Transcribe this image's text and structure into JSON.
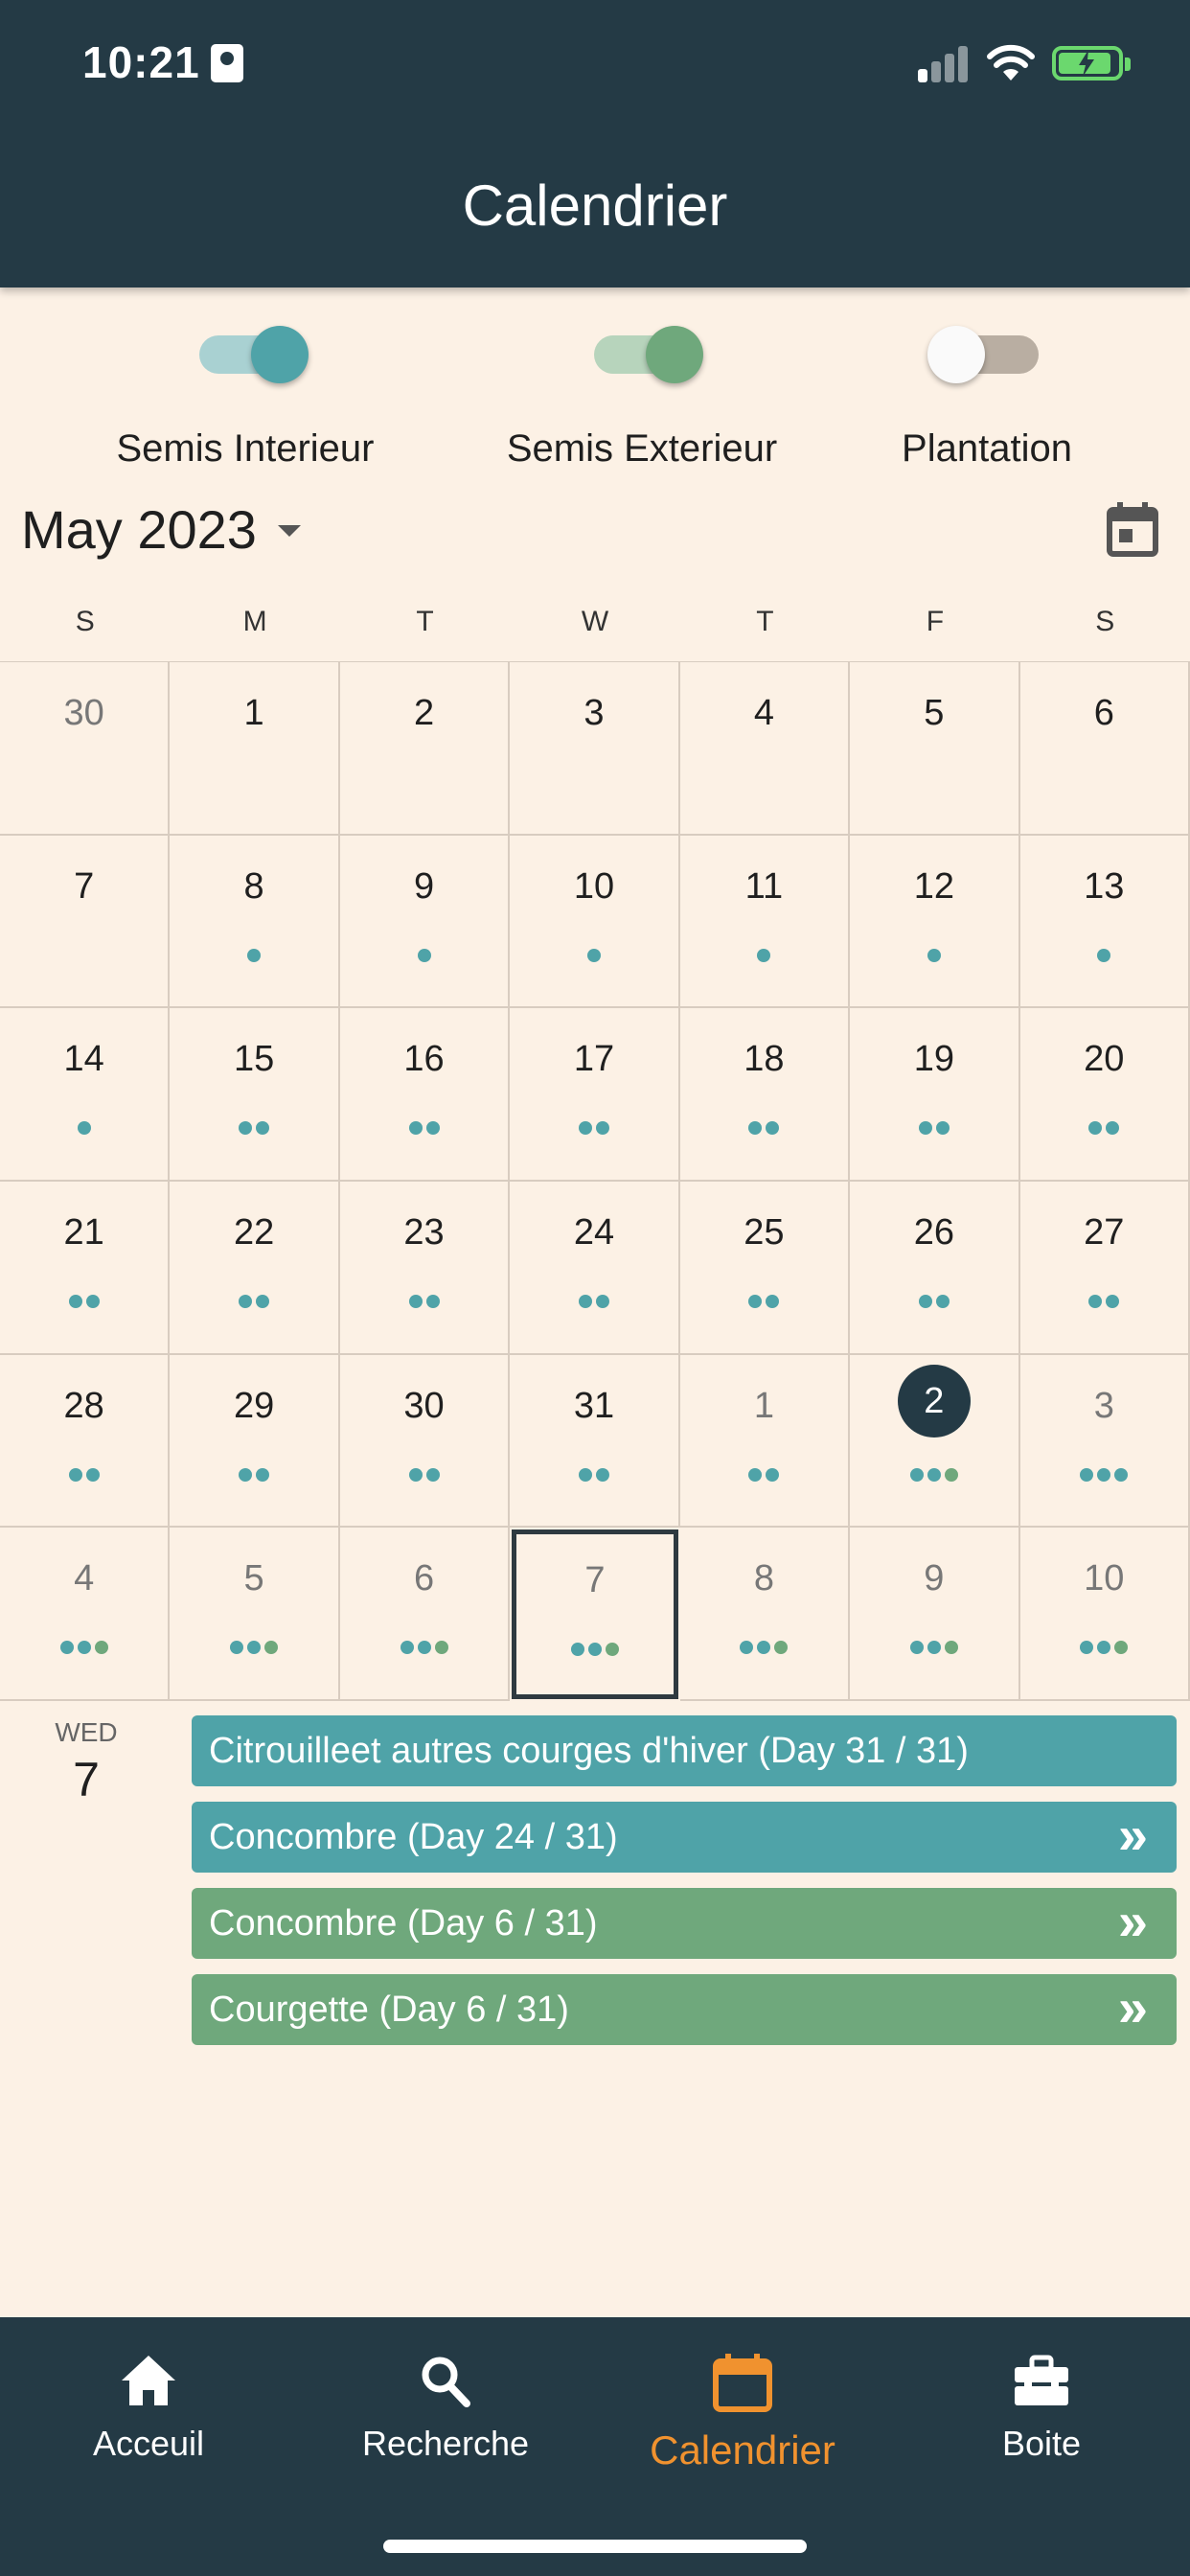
{
  "status_bar": {
    "time": "10:21"
  },
  "header": {
    "title": "Calendrier"
  },
  "filters": [
    {
      "label": "Semis Interieur",
      "on": true,
      "color": "#4FA3A8"
    },
    {
      "label": "Semis Exterieur",
      "on": true,
      "color": "#6FA87C"
    },
    {
      "label": "Plantation",
      "on": false,
      "color": "#B9AEA2"
    }
  ],
  "month_title": "May 2023",
  "weekdays": [
    "S",
    "M",
    "T",
    "W",
    "T",
    "F",
    "S"
  ],
  "colors": {
    "teal": "#4FA3A8",
    "green": "#6FA87C",
    "dark": "#243A45",
    "accent": "#F0922F",
    "background": "#FCF1E5"
  },
  "calendar_days": [
    {
      "d": "30",
      "m": true,
      "dots": []
    },
    {
      "d": "1",
      "dots": []
    },
    {
      "d": "2",
      "dots": []
    },
    {
      "d": "3",
      "dots": []
    },
    {
      "d": "4",
      "dots": []
    },
    {
      "d": "5",
      "dots": []
    },
    {
      "d": "6",
      "dots": []
    },
    {
      "d": "7",
      "dots": []
    },
    {
      "d": "8",
      "dots": [
        "teal"
      ]
    },
    {
      "d": "9",
      "dots": [
        "teal"
      ]
    },
    {
      "d": "10",
      "dots": [
        "teal"
      ]
    },
    {
      "d": "11",
      "dots": [
        "teal"
      ]
    },
    {
      "d": "12",
      "dots": [
        "teal"
      ]
    },
    {
      "d": "13",
      "dots": [
        "teal"
      ]
    },
    {
      "d": "14",
      "dots": [
        "teal"
      ]
    },
    {
      "d": "15",
      "dots": [
        "teal",
        "teal"
      ]
    },
    {
      "d": "16",
      "dots": [
        "teal",
        "teal"
      ]
    },
    {
      "d": "17",
      "dots": [
        "teal",
        "teal"
      ]
    },
    {
      "d": "18",
      "dots": [
        "teal",
        "teal"
      ]
    },
    {
      "d": "19",
      "dots": [
        "teal",
        "teal"
      ]
    },
    {
      "d": "20",
      "dots": [
        "teal",
        "teal"
      ]
    },
    {
      "d": "21",
      "dots": [
        "teal",
        "teal"
      ]
    },
    {
      "d": "22",
      "dots": [
        "teal",
        "teal"
      ]
    },
    {
      "d": "23",
      "dots": [
        "teal",
        "teal"
      ]
    },
    {
      "d": "24",
      "dots": [
        "teal",
        "teal"
      ]
    },
    {
      "d": "25",
      "dots": [
        "teal",
        "teal"
      ]
    },
    {
      "d": "26",
      "dots": [
        "teal",
        "teal"
      ]
    },
    {
      "d": "27",
      "dots": [
        "teal",
        "teal"
      ]
    },
    {
      "d": "28",
      "dots": [
        "teal",
        "teal"
      ]
    },
    {
      "d": "29",
      "dots": [
        "teal",
        "teal"
      ]
    },
    {
      "d": "30",
      "dots": [
        "teal",
        "teal"
      ]
    },
    {
      "d": "31",
      "dots": [
        "teal",
        "teal"
      ]
    },
    {
      "d": "1",
      "m": true,
      "dots": [
        "teal",
        "teal"
      ]
    },
    {
      "d": "2",
      "sel": true,
      "dots": [
        "teal",
        "teal",
        "green"
      ]
    },
    {
      "d": "3",
      "m": true,
      "dots": [
        "teal",
        "teal",
        "teal"
      ]
    },
    {
      "d": "4",
      "m": true,
      "dots": [
        "teal",
        "teal",
        "green"
      ]
    },
    {
      "d": "5",
      "m": true,
      "dots": [
        "teal",
        "teal",
        "green"
      ]
    },
    {
      "d": "6",
      "m": true,
      "dots": [
        "teal",
        "teal",
        "green"
      ]
    },
    {
      "d": "7",
      "m": true,
      "today": true,
      "dots": [
        "teal",
        "teal",
        "green"
      ]
    },
    {
      "d": "8",
      "m": true,
      "dots": [
        "teal",
        "teal",
        "green"
      ]
    },
    {
      "d": "9",
      "m": true,
      "dots": [
        "teal",
        "teal",
        "green"
      ]
    },
    {
      "d": "10",
      "m": true,
      "dots": [
        "teal",
        "teal",
        "green"
      ]
    }
  ],
  "agenda": {
    "weekday": "WED",
    "date": "7",
    "events": [
      {
        "title": "Citrouilleet autres courges d'hiver (Day 31 / 31)",
        "color": "teal",
        "has_chevron": false
      },
      {
        "title": "Concombre (Day 24 / 31)",
        "color": "teal",
        "has_chevron": true
      },
      {
        "title": "Concombre (Day 6 / 31)",
        "color": "green",
        "has_chevron": true
      },
      {
        "title": "Courgette (Day 6 / 31)",
        "color": "green",
        "has_chevron": true
      }
    ],
    "chevron": "»"
  },
  "bottom_nav": [
    {
      "label": "Acceuil",
      "icon": "home-icon",
      "active": false
    },
    {
      "label": "Recherche",
      "icon": "search-icon",
      "active": false
    },
    {
      "label": "Calendrier",
      "icon": "calendar-icon",
      "active": true
    },
    {
      "label": "Boite",
      "icon": "toolbox-icon",
      "active": false
    }
  ]
}
